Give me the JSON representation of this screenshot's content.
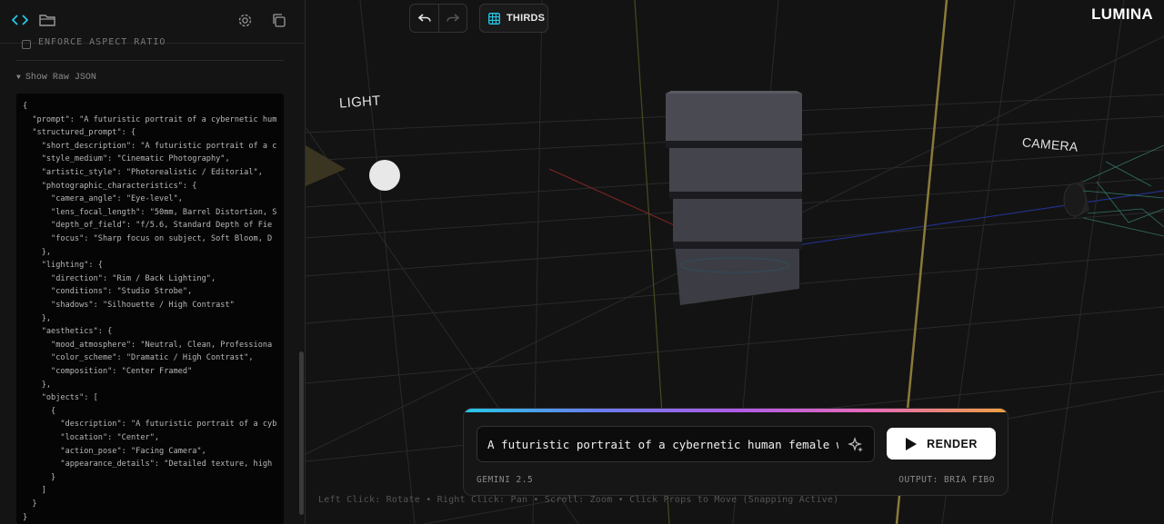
{
  "sidebar": {
    "toolbar": {
      "code_icon": "code-icon",
      "folder_icon": "folder-icon",
      "settings_icon": "gear-icon",
      "copy_icon": "copy-icon"
    },
    "cut_option_label": "ENFORCE ASPECT RATIO",
    "raw_json_toggle": "Show Raw JSON",
    "raw_json_lines": [
      "{",
      "  \"prompt\": \"A futuristic portrait of a cybernetic hum",
      "  \"structured_prompt\": {",
      "    \"short_description\": \"A futuristic portrait of a c",
      "    \"style_medium\": \"Cinematic Photography\",",
      "    \"artistic_style\": \"Photorealistic / Editorial\",",
      "    \"photographic_characteristics\": {",
      "      \"camera_angle\": \"Eye-level\",",
      "      \"lens_focal_length\": \"50mm, Barrel Distortion, S",
      "      \"depth_of_field\": \"f/5.6, Standard Depth of Fie",
      "      \"focus\": \"Sharp focus on subject, Soft Bloom, D",
      "    },",
      "    \"lighting\": {",
      "      \"direction\": \"Rim / Back Lighting\",",
      "      \"conditions\": \"Studio Strobe\",",
      "      \"shadows\": \"Silhouette / High Contrast\"",
      "    },",
      "    \"aesthetics\": {",
      "      \"mood_atmosphere\": \"Neutral, Clean, Professiona",
      "      \"color_scheme\": \"Dramatic / High Contrast\",",
      "      \"composition\": \"Center Framed\"",
      "    },",
      "    \"objects\": [",
      "      {",
      "        \"description\": \"A futuristic portrait of a cyb",
      "        \"location\": \"Center\",",
      "        \"action_pose\": \"Facing Camera\",",
      "        \"appearance_details\": \"Detailed texture, high",
      "      }",
      "    ]",
      "  }",
      "}"
    ]
  },
  "viewport": {
    "undo_icon": "undo-icon",
    "redo_icon": "redo-icon",
    "thirds_label": "THIRDS",
    "thirds_icon": "grid-icon",
    "brand": "LUMINA",
    "light_label": "LIGHT",
    "camera_label": "CAMERA",
    "prompt": {
      "value": "A futuristic portrait of a cybernetic human female wi",
      "sparkle_icon": "sparkle-icon",
      "render_label": "RENDER",
      "model": "GEMINI 2.5",
      "output": "OUTPUT: BRIA FIBO"
    },
    "hint": "Left Click: Rotate • Right Click: Pan • Scroll: Zoom • Click Props to Move (Snapping Active)"
  },
  "colors": {
    "accent_cyan": "#27c8e8",
    "grid_gold": "#8a7a3a",
    "axis_red": "#a03030",
    "axis_blue": "#2a3aa0"
  }
}
